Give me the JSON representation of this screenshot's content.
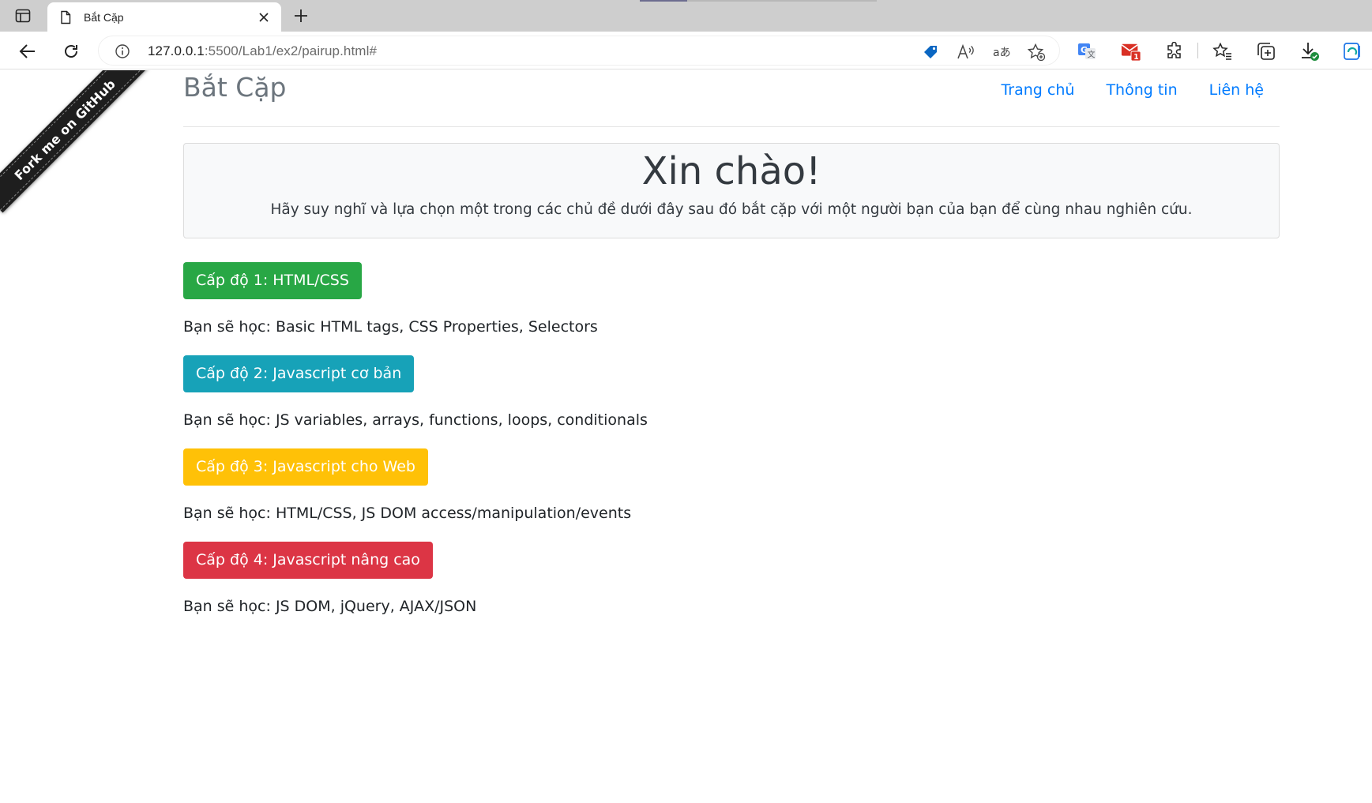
{
  "browser": {
    "tab_title": "Bắt Cặp",
    "url_host": "127.0.0.1",
    "url_path": ":5500/Lab1/ex2/pairup.html#",
    "mail_badge": "1"
  },
  "header": {
    "brand": "Bắt Cặp",
    "nav": [
      "Trang chủ",
      "Thông tin",
      "Liên hệ"
    ]
  },
  "ribbon": {
    "text": "Fork me on GitHub"
  },
  "hero": {
    "title": "Xin chào!",
    "subtitle": "Hãy suy nghĩ và lựa chọn một trong các chủ đề dưới đây sau đó bắt cặp với một người bạn của bạn để cùng nhau nghiên cứu."
  },
  "levels": [
    {
      "button": "Cấp độ 1: HTML/CSS",
      "color": "#28a745",
      "desc": "Bạn sẽ học: Basic HTML tags, CSS Properties, Selectors"
    },
    {
      "button": "Cấp độ 2: Javascript cơ bản",
      "color": "#17a2b8",
      "desc": "Bạn sẽ học: JS variables, arrays, functions, loops, conditionals"
    },
    {
      "button": "Cấp độ 3: Javascript cho Web",
      "color": "#ffc107",
      "desc": "Bạn sẽ học: HTML/CSS, JS DOM access/manipulation/events"
    },
    {
      "button": "Cấp độ 4: Javascript nâng cao",
      "color": "#dc3545",
      "desc": "Bạn sẽ học: JS DOM, jQuery, AJAX/JSON"
    }
  ]
}
